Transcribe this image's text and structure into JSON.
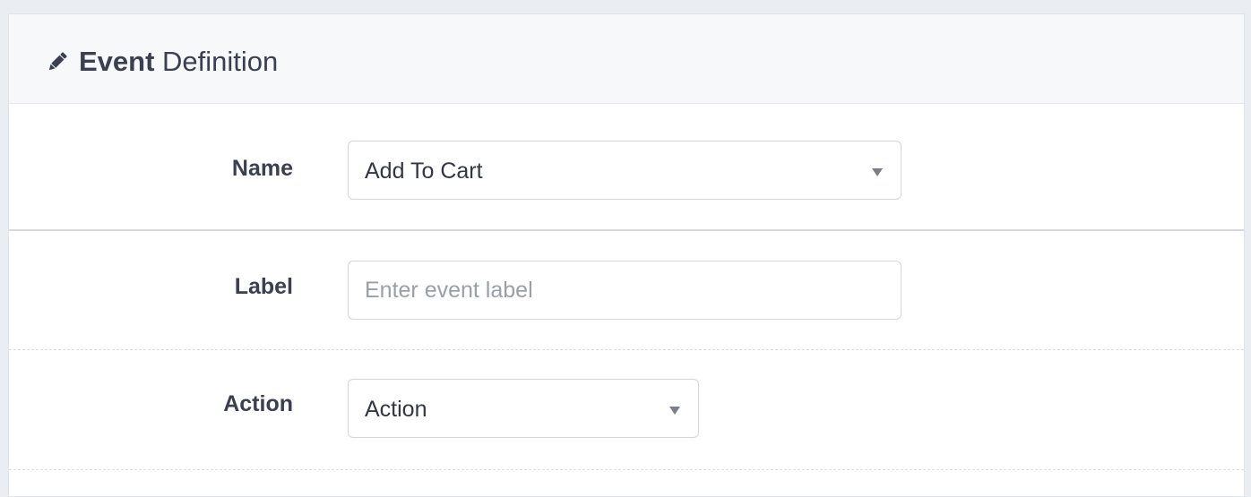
{
  "header": {
    "title_strong": "Event",
    "title_rest": " Definition",
    "icon": "pencil-icon"
  },
  "form": {
    "name": {
      "label": "Name",
      "selected": "Add To Cart"
    },
    "label": {
      "label": "Label",
      "placeholder": "Enter event label",
      "value": ""
    },
    "action": {
      "label": "Action",
      "selected": "Action"
    }
  },
  "colors": {
    "background": "#eaedf2",
    "header_bg": "#f7f8fa",
    "text": "#3a3f51",
    "placeholder": "#9aa0a8",
    "border": "#d3d6dc"
  }
}
